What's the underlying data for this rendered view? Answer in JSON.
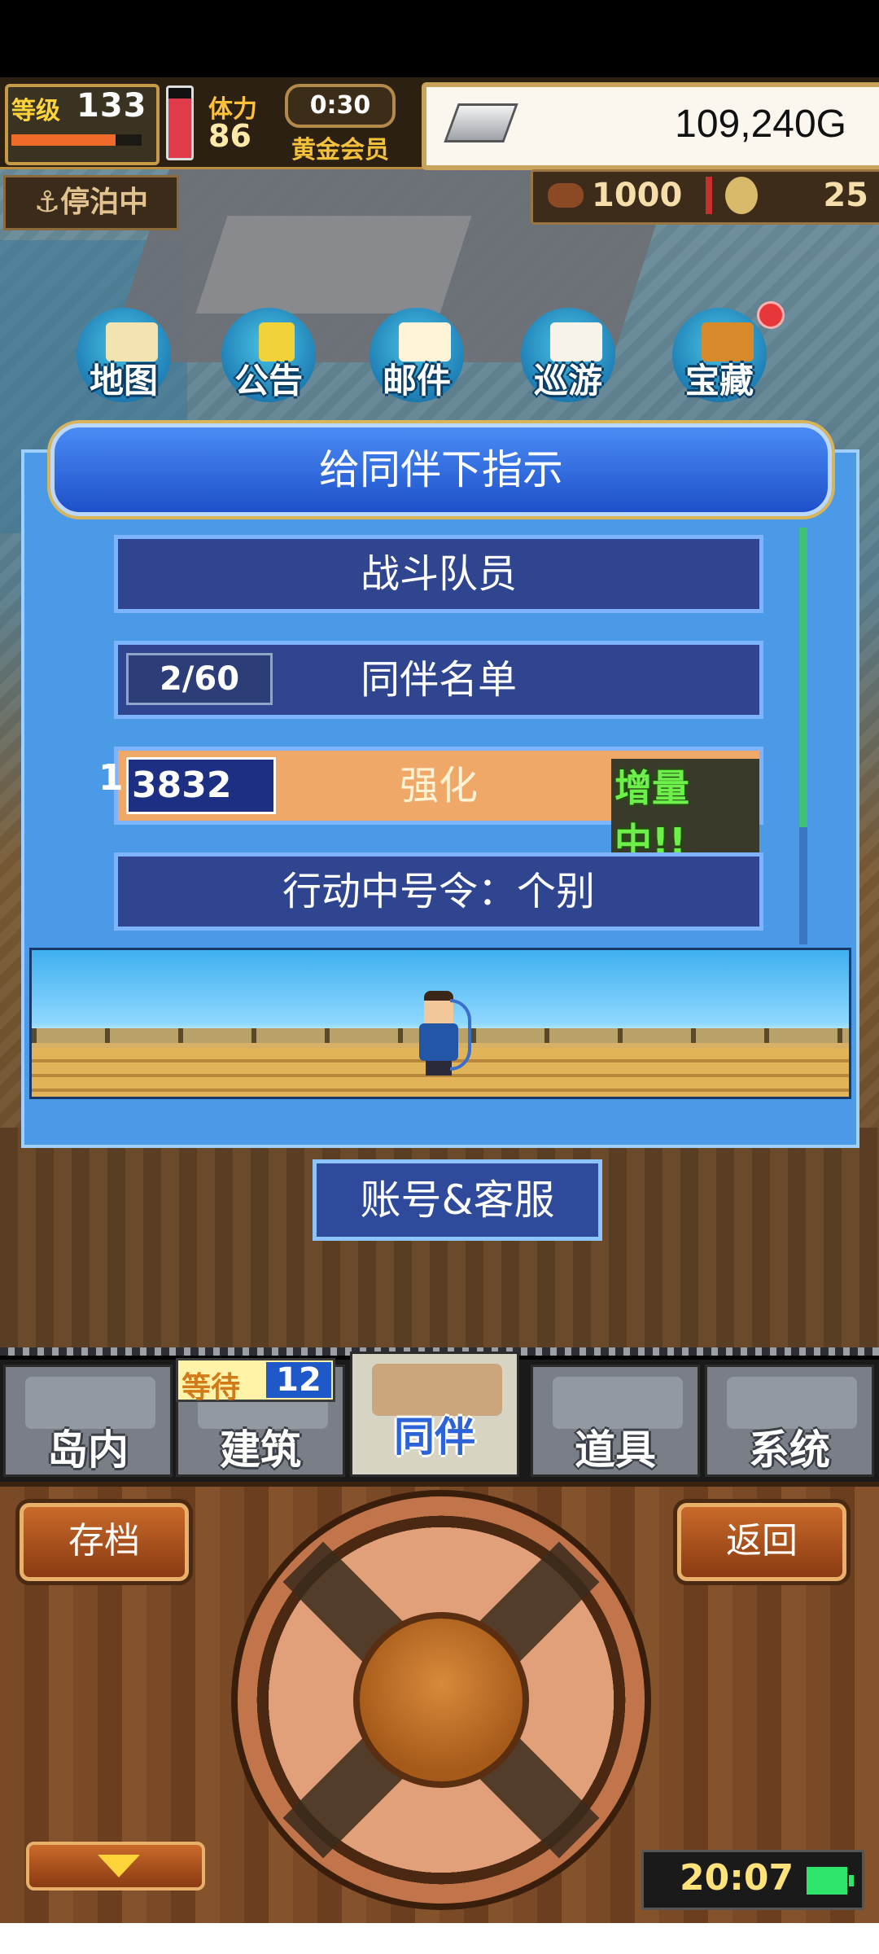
{
  "hud": {
    "level_label": "等级",
    "level_value": "133",
    "level_progress": 0.8,
    "stamina_label": "体力",
    "stamina_value": "86",
    "stamina_level": 0.85,
    "timer": "0:30",
    "membership": "黄金会员",
    "money": "109,240G"
  },
  "status": {
    "dock_status": "⚓停泊中",
    "resource_a": "1000",
    "resource_b": "25"
  },
  "menu": [
    {
      "label": "地图",
      "icon": "map-icon"
    },
    {
      "label": "公告",
      "icon": "notice-board-icon"
    },
    {
      "label": "邮件",
      "icon": "mail-icon"
    },
    {
      "label": "巡游",
      "icon": "ship-icon"
    },
    {
      "label": "宝藏",
      "icon": "treasure-chest-icon"
    }
  ],
  "dialog": {
    "title": "给同伴下指示",
    "options": [
      {
        "label": "战斗队员"
      },
      {
        "label": "同伴名单",
        "count": "2/60"
      },
      {
        "label": "强化",
        "score_lead": "1",
        "score": "3832",
        "tag": "增量中!!"
      },
      {
        "label": "行动中号令：个别"
      }
    ]
  },
  "support_button": "账号&客服",
  "tabs": [
    {
      "label": "岛内"
    },
    {
      "label": "建筑"
    },
    {
      "label": "同伴"
    },
    {
      "label": "道具"
    },
    {
      "label": "系统"
    }
  ],
  "wait_badge": {
    "label": "等待",
    "value": "12"
  },
  "controller": {
    "save": "存档",
    "back": "返回"
  },
  "clock": "20:07",
  "colors": {
    "dialog_bg": "#4b9ae8",
    "option_bg": "#2f4590",
    "active_option": "#f0a868",
    "boost_green": "#6df04a",
    "money_bg": "#fbf7ee"
  }
}
